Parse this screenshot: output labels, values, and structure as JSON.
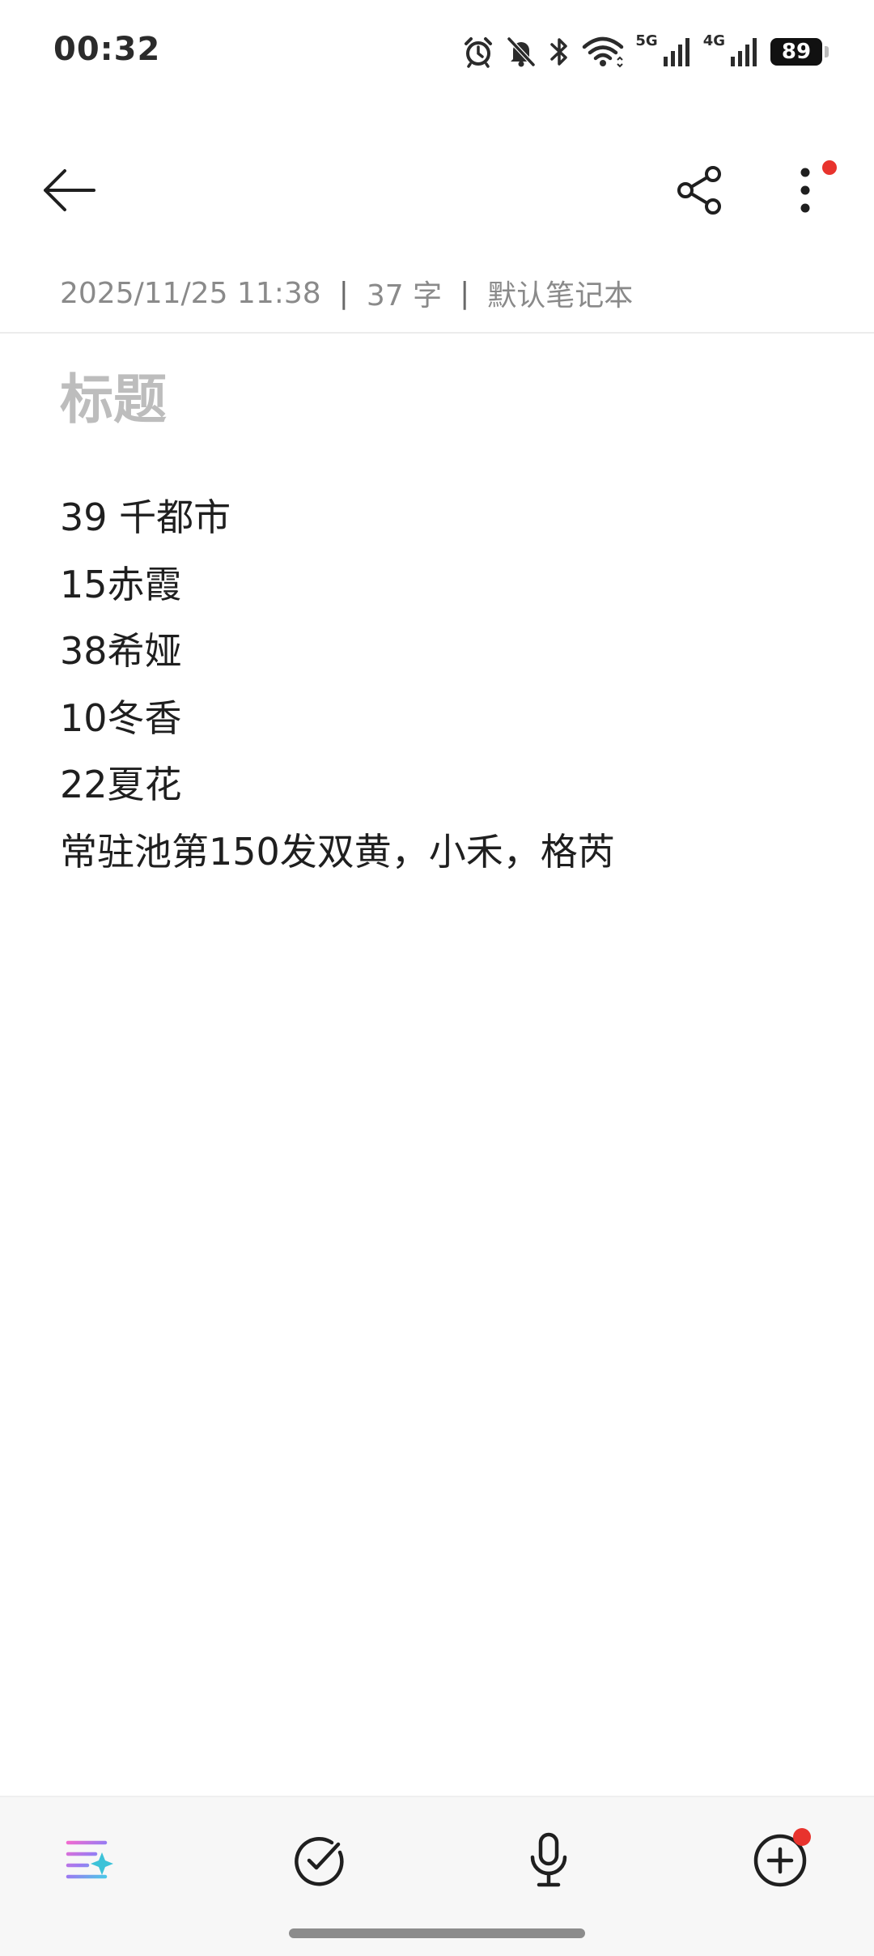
{
  "status_bar": {
    "time": "00:32",
    "signal_5g_label": "5G",
    "signal_4g_label": "4G",
    "battery_level": "89",
    "icons": [
      "alarm-icon",
      "mute-icon",
      "bluetooth-icon",
      "wifi-icon",
      "signal-5g-icon",
      "signal-4g-icon",
      "battery-icon"
    ]
  },
  "toolbar": {
    "icons": [
      "back-arrow-icon",
      "share-icon",
      "more-vertical-icon"
    ],
    "notification_color": "#e8332d"
  },
  "meta": {
    "datetime": "2025/11/25 11:38",
    "separator": "|",
    "word_count": "37 字",
    "notebook": "默认笔记本"
  },
  "note": {
    "title_placeholder": "标题",
    "lines": [
      "39 千都市",
      "15赤霞",
      "38希娅",
      "10冬香",
      "22夏花",
      "常驻池第150发双黄，小禾，格芮"
    ]
  },
  "bottom_bar": {
    "icons": [
      "ai-format-icon",
      "checklist-icon",
      "microphone-icon",
      "add-circle-icon"
    ],
    "notification_color": "#e8332d"
  }
}
